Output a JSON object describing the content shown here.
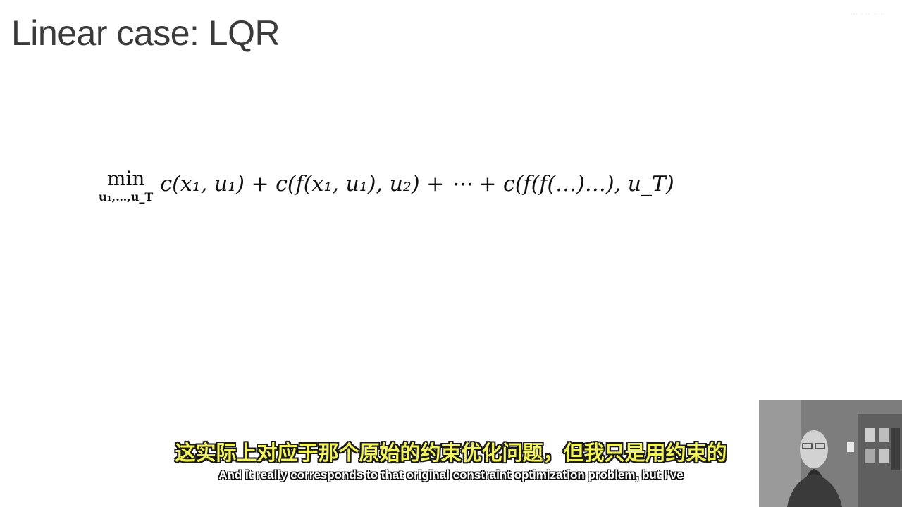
{
  "slide": {
    "title": "Linear case: LQR",
    "watermark": "··· · ·· ·· ··"
  },
  "equation": {
    "operator": "min",
    "subscript": "u₁,…,u_T",
    "expression": "c(x₁, u₁) + c(f(x₁, u₁), u₂) + ⋯ + c(f(f(…)…), u_T)"
  },
  "subtitles": {
    "chinese": "这实际上对应于那个原始的约束优化问题，但我只是用约束的",
    "english": "And it really corresponds to that original constraint optimization problem, but I've"
  },
  "webcam": {
    "description_icon": "presenter-webcam"
  }
}
